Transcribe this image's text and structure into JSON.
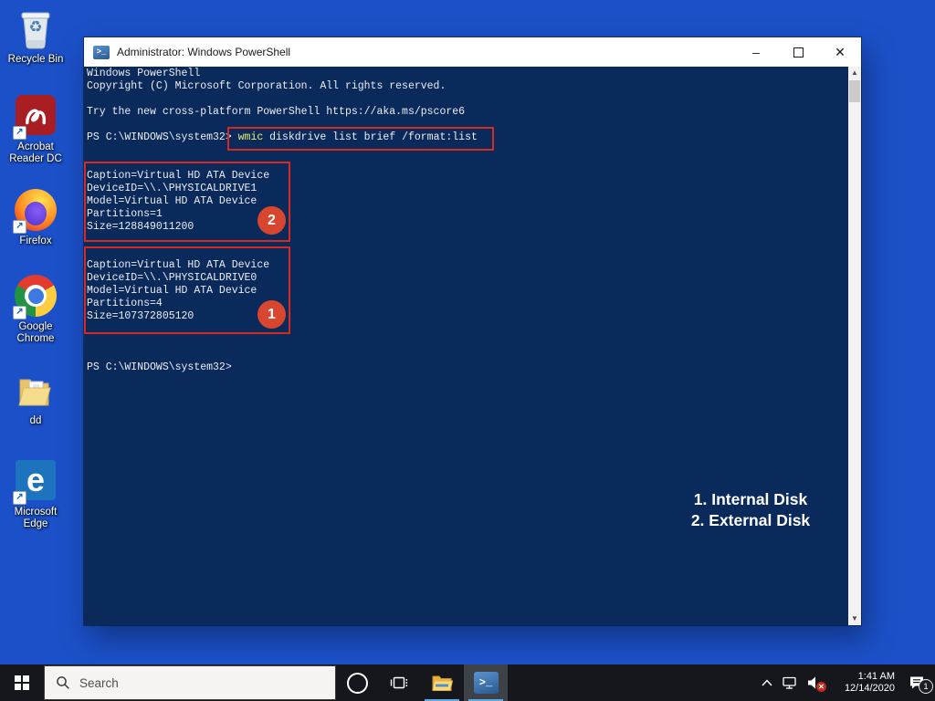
{
  "desktop": {
    "background_color": "#1b50c8",
    "icons": [
      {
        "label": "Recycle Bin"
      },
      {
        "label": "Acrobat Reader DC"
      },
      {
        "label": "Firefox"
      },
      {
        "label": "Google Chrome"
      },
      {
        "label": "dd"
      },
      {
        "label": "Microsoft Edge"
      }
    ],
    "recycle_glyph": "♻",
    "edge_glyph": "e",
    "shortcut_glyph": "↗"
  },
  "window": {
    "title": "Administrator: Windows PowerShell",
    "icon_glyph": ">_",
    "minimize_glyph": "–",
    "close_glyph": "✕"
  },
  "console": {
    "colors": {
      "background": "#0a2a5c",
      "text": "#eeedf0",
      "command_highlight": "#ecec6f"
    },
    "banner": [
      "Windows PowerShell",
      "Copyright (C) Microsoft Corporation. All rights reserved."
    ],
    "tip": "Try the new cross-platform PowerShell https://aka.ms/pscore6",
    "command": {
      "prompt": "PS C:\\WINDOWS\\system32> ",
      "executable": "wmic",
      "arguments": " diskdrive list brief /format:list"
    },
    "blocks": [
      {
        "badge": "2",
        "lines": [
          "Caption=Virtual HD ATA Device",
          "DeviceID=\\\\.\\PHYSICALDRIVE1",
          "Model=Virtual HD ATA Device",
          "Partitions=1",
          "Size=128849011200"
        ]
      },
      {
        "badge": "1",
        "lines": [
          "Caption=Virtual HD ATA Device",
          "DeviceID=\\\\.\\PHYSICALDRIVE0",
          "Model=Virtual HD ATA Device",
          "Partitions=4",
          "Size=107372805120"
        ]
      }
    ],
    "final_prompt": "PS C:\\WINDOWS\\system32>"
  },
  "annotations": {
    "box_color": "#d42a20",
    "badge_color": "#d8462f",
    "legend": [
      "1. Internal Disk",
      "2. External Disk"
    ]
  },
  "taskbar": {
    "search_placeholder": "Search",
    "powershell_glyph": ">_",
    "tray": {
      "time": "1:41 AM",
      "date": "12/14/2020",
      "notification_count": "1"
    }
  }
}
